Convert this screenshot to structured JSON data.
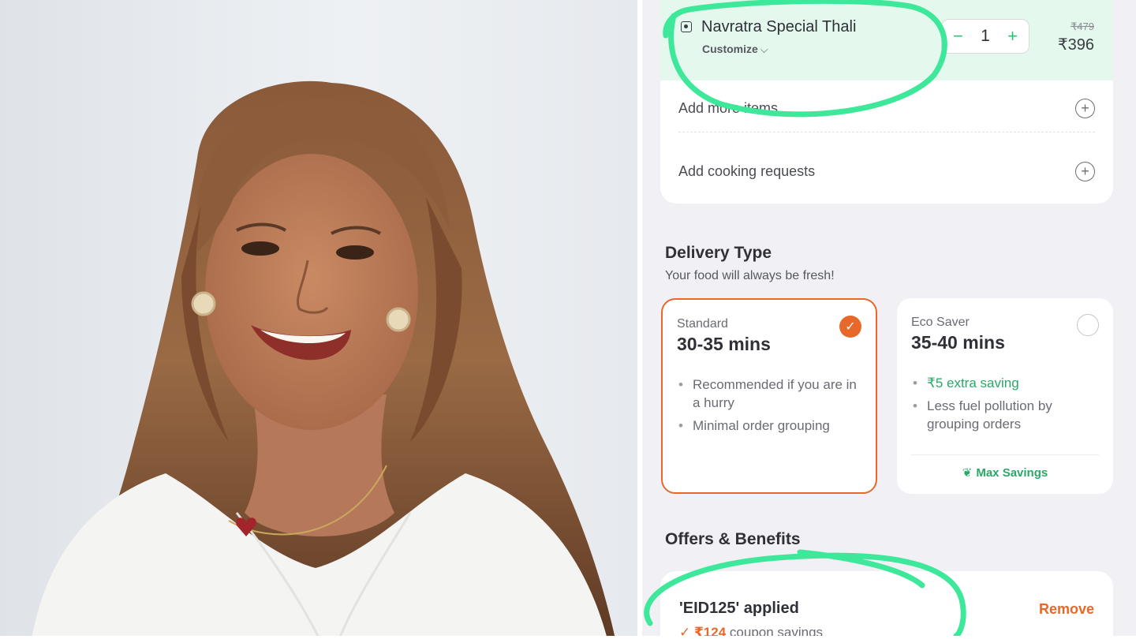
{
  "cart": {
    "item_name": "Navratra Special Thali",
    "customize_label": "Customize",
    "quantity": "1",
    "decrement_symbol": "−",
    "increment_symbol": "+",
    "price_original": "₹479",
    "price_current": "₹396",
    "add_items_label": "Add more items",
    "cooking_requests_label": "Add cooking requests"
  },
  "delivery": {
    "title": "Delivery Type",
    "subtitle": "Your food will always be fresh!",
    "options": [
      {
        "label": "Standard",
        "time": "30-35 mins",
        "selected": true,
        "points": [
          "Recommended if you are in a hurry",
          "Minimal order grouping"
        ]
      },
      {
        "label": "Eco Saver",
        "time": "35-40 mins",
        "selected": false,
        "points": [
          "₹5 extra saving",
          "Less fuel pollution by grouping orders"
        ],
        "footer": "Max Savings"
      }
    ]
  },
  "offers": {
    "title": "Offers & Benefits",
    "coupon_applied": "'EID125' applied",
    "remove_label": "Remove",
    "savings_amount": "₹124",
    "savings_text": "coupon savings"
  },
  "icons": {
    "veg": "veg-indicator-icon",
    "plus": "plus-circle-icon",
    "check": "check-icon",
    "leaf": "sprout-icon",
    "chevron": "chevron-down-icon"
  },
  "colors": {
    "accent_orange": "#e8682a",
    "accent_green": "#2bbf73",
    "highlight_row": "#e4f8ee",
    "marker_green": "#3ee89a",
    "panel_bg": "#f0f0f5"
  }
}
